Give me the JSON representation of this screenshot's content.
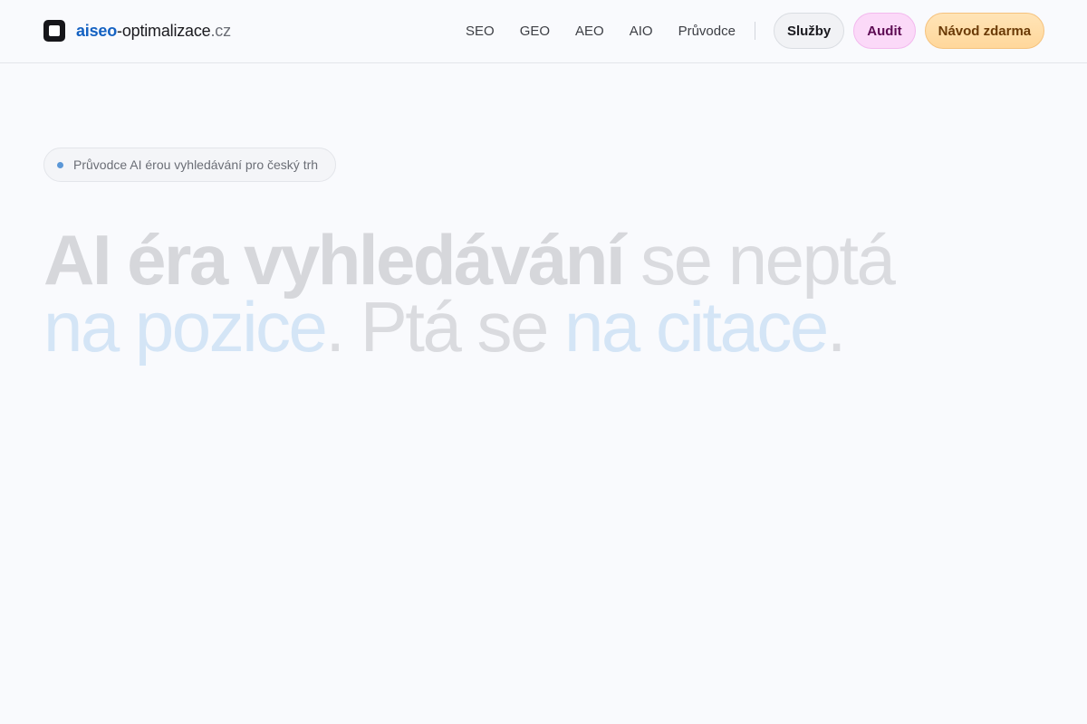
{
  "header": {
    "logo": {
      "part_brand": "aiseo",
      "part_main": "-optimalizace",
      "part_tld": ".cz",
      "icon": "logo-square-icon"
    },
    "nav": [
      {
        "label": "SEO"
      },
      {
        "label": "GEO"
      },
      {
        "label": "AEO"
      },
      {
        "label": "AIO"
      },
      {
        "label": "Průvodce"
      }
    ],
    "buttons": {
      "services": "Služby",
      "audit": "Audit",
      "free_guide": "Návod zdarma"
    }
  },
  "hero": {
    "badge": "Průvodce AI érou vyhledávání pro český trh",
    "headline": {
      "line1_strong": "AI éra vyhledávání",
      "line1_light": " se neptá",
      "line2_blue1": "na pozice",
      "line2_light1": ". Ptá se ",
      "line2_blue2": "na citace",
      "line2_light2": "."
    }
  },
  "colors": {
    "background": "#f9fafd",
    "brand_blue": "#1562c2",
    "audit_pill": "#fbd9f8",
    "guide_pill": "#ffd79b",
    "badge_dot": "#5b97d7"
  }
}
